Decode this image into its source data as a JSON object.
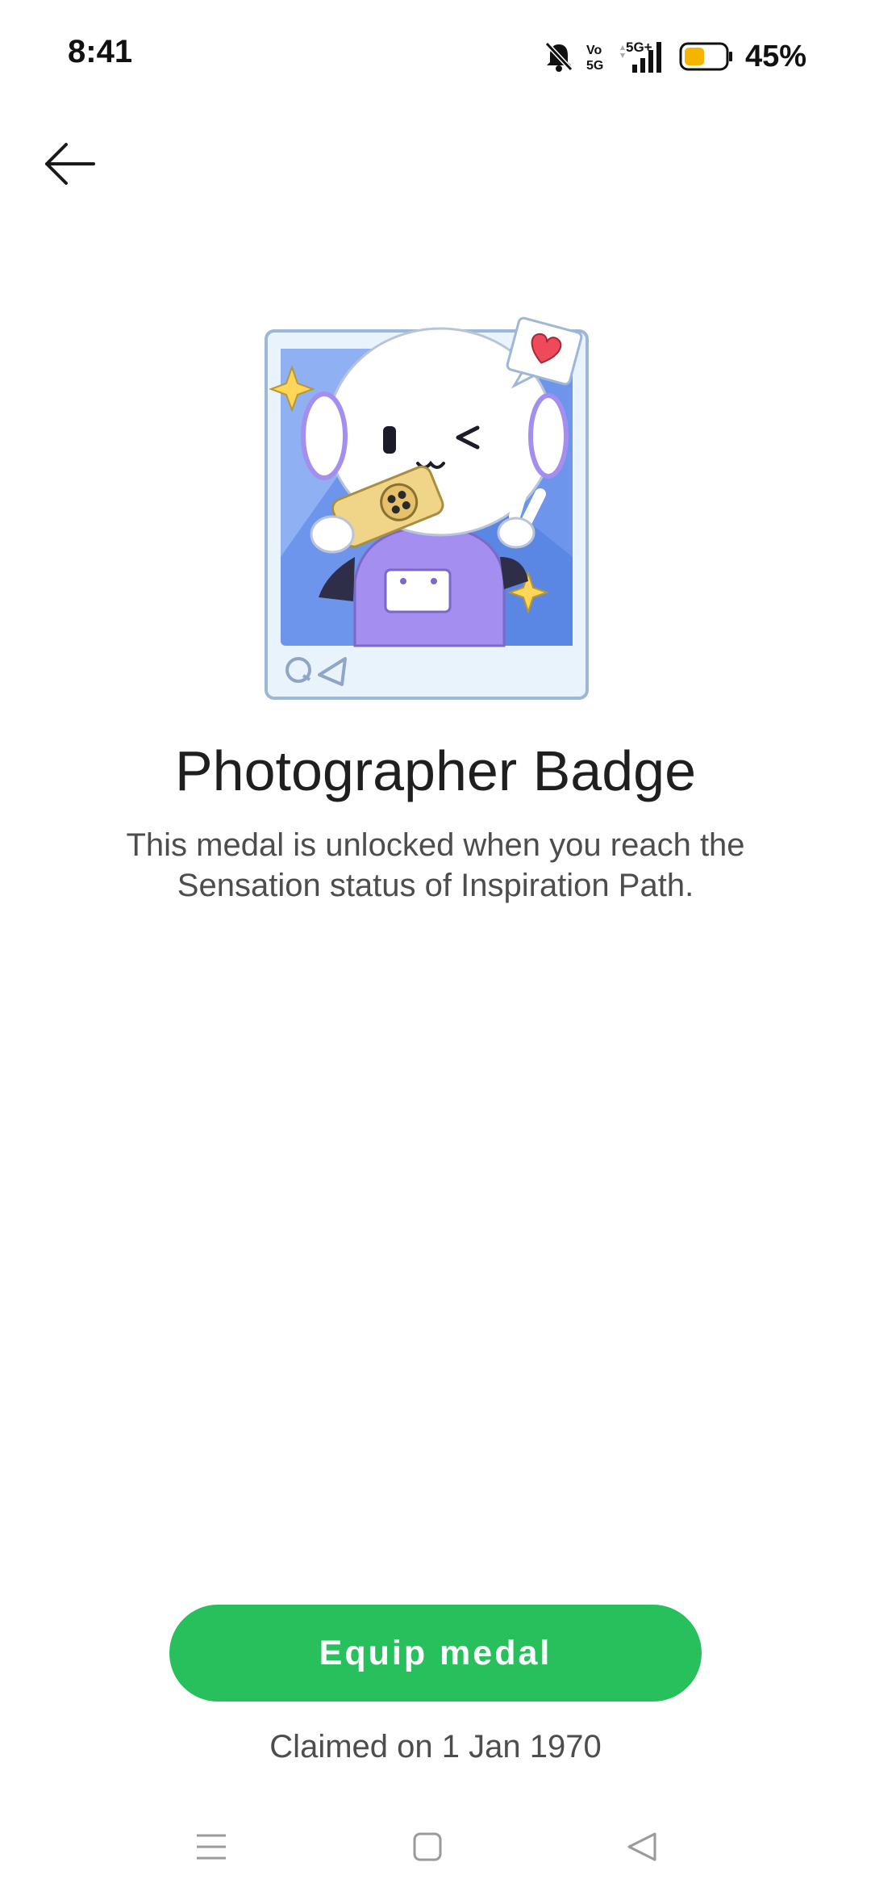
{
  "status_bar": {
    "time": "8:41",
    "battery_percent": "45%",
    "icons": [
      "bell-muted-icon",
      "volte-5g-icon",
      "signal-5g-plus-icon",
      "battery-icon"
    ],
    "battery_color": "#f5b400"
  },
  "header": {
    "back_icon": "arrow-left-icon"
  },
  "badge": {
    "image": "photographer-badge-illustration",
    "title": "Photographer Badge",
    "description": "This medal is unlocked when you reach the Sensation status of Inspiration Path."
  },
  "actions": {
    "equip_label": "Equip medal",
    "accent_color": "#27c05c",
    "claimed_text": "Claimed on 1 Jan 1970"
  },
  "nav_bar": {
    "icons": [
      "menu-icon",
      "home-square-icon",
      "back-triangle-icon"
    ]
  }
}
